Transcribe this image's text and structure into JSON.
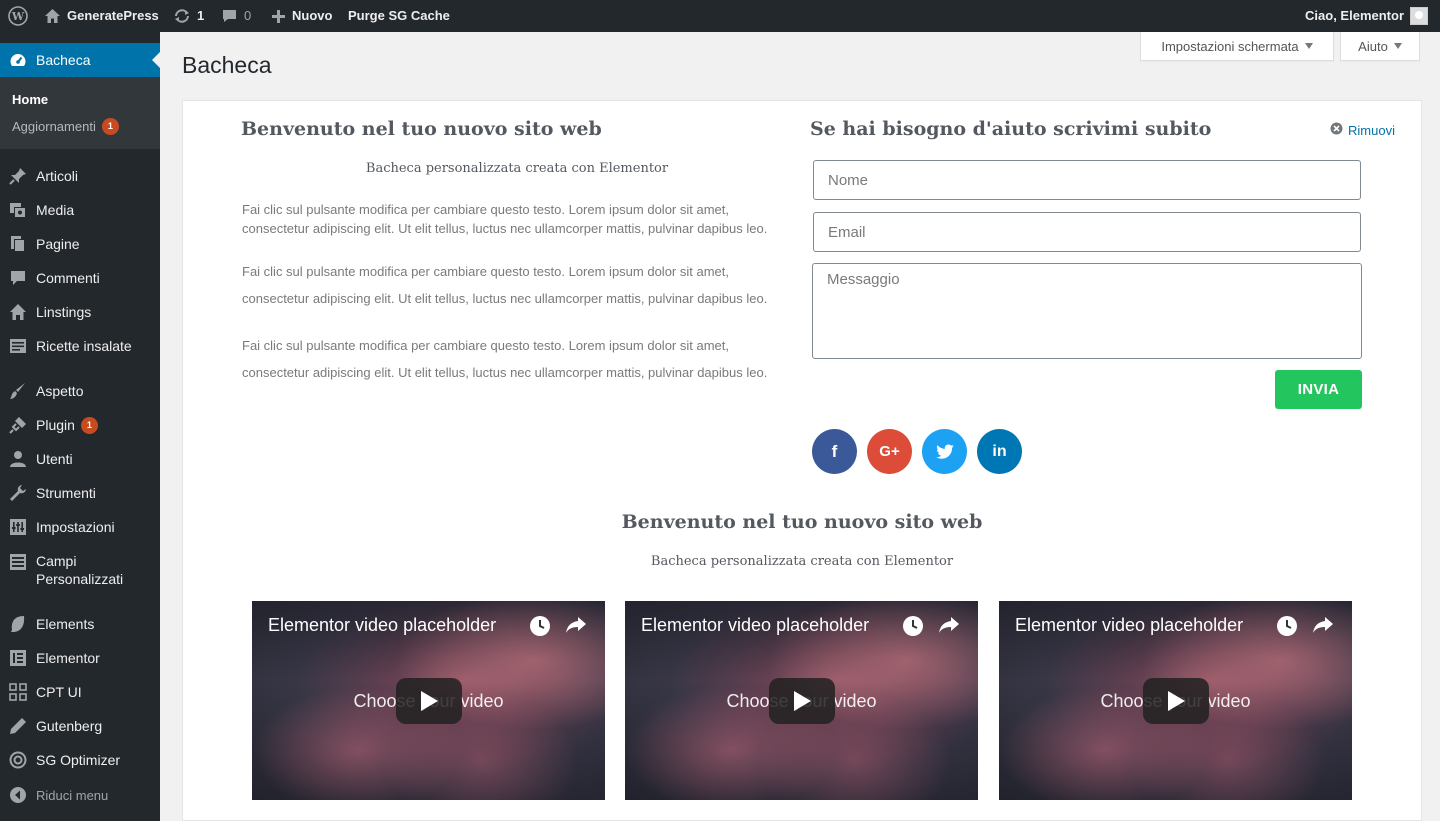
{
  "adminbar": {
    "site_name": "GeneratePress",
    "updates_count": "1",
    "comments_count": "0",
    "new_label": "Nuovo",
    "purge_label": "Purge SG Cache",
    "greeting": "Ciao, Elementor"
  },
  "sidebar": {
    "dashboard": "Bacheca",
    "sub_home": "Home",
    "sub_updates": "Aggiornamenti",
    "sub_updates_badge": "1",
    "items": [
      {
        "label": "Articoli",
        "icon": "pin-icon"
      },
      {
        "label": "Media",
        "icon": "media-icon"
      },
      {
        "label": "Pagine",
        "icon": "pages-icon"
      },
      {
        "label": "Commenti",
        "icon": "comments-icon"
      },
      {
        "label": "Linstings",
        "icon": "home-icon"
      },
      {
        "label": "Ricette insalate",
        "icon": "post-icon"
      },
      {
        "label": "Aspetto",
        "icon": "brush-icon"
      },
      {
        "label": "Plugin",
        "icon": "plugin-icon",
        "badge": "1"
      },
      {
        "label": "Utenti",
        "icon": "user-icon"
      },
      {
        "label": "Strumenti",
        "icon": "wrench-icon"
      },
      {
        "label": "Impostazioni",
        "icon": "settings-icon"
      },
      {
        "label": "Campi",
        "label2": "Personalizzati",
        "icon": "fields-icon"
      },
      {
        "label": "Elements",
        "icon": "leaf-icon"
      },
      {
        "label": "Elementor",
        "icon": "elementor-icon"
      },
      {
        "label": "CPT UI",
        "icon": "grid-icon"
      },
      {
        "label": "Gutenberg",
        "icon": "pen-icon"
      },
      {
        "label": "SG Optimizer",
        "icon": "sg-icon"
      }
    ],
    "collapse_label": "Riduci menu"
  },
  "header": {
    "title": "Bacheca",
    "screen_options": "Impostazioni schermata",
    "help": "Aiuto"
  },
  "welcome": {
    "heading": "Benvenuto nel tuo nuovo sito web",
    "subheading": "Bacheca personalizzata creata con Elementor",
    "p1": "Fai clic sul pulsante modifica per cambiare questo testo. Lorem ipsum dolor sit amet, consectetur adipiscing elit. Ut elit tellus, luctus nec ullamcorper mattis, pulvinar dapibus leo.",
    "p2_line1": "Fai clic sul pulsante modifica per cambiare questo testo. Lorem ipsum dolor sit amet,",
    "p2_line2": "consectetur adipiscing elit. Ut elit tellus, luctus nec ullamcorper mattis, pulvinar dapibus leo.",
    "p3_line1": "Fai clic sul pulsante modifica per cambiare questo testo. Lorem ipsum dolor sit amet,",
    "p3_line2": "consectetur adipiscing elit. Ut elit tellus, luctus nec ullamcorper mattis, pulvinar dapibus leo."
  },
  "contact": {
    "heading": "Se hai bisogno d'aiuto scrivimi subito",
    "remove": "Rimuovi",
    "name_placeholder": "Nome",
    "email_placeholder": "Email",
    "message_placeholder": "Messaggio",
    "send": "INVIA",
    "social": [
      {
        "name": "facebook-icon",
        "glyph": "f",
        "color": "#3b5998"
      },
      {
        "name": "google-plus-icon",
        "glyph": "G+",
        "color": "#dd4b39"
      },
      {
        "name": "twitter-icon",
        "glyph": "t",
        "color": "#1da1f2"
      },
      {
        "name": "linkedin-icon",
        "glyph": "in",
        "color": "#0077b5"
      }
    ]
  },
  "bottom": {
    "heading": "Benvenuto nel tuo nuovo sito web",
    "subheading": "Bacheca personalizzata creata con Elementor"
  },
  "videos": [
    {
      "title": "Elementor video placeholder",
      "caption": "Choose your video"
    },
    {
      "title": "Elementor video placeholder",
      "caption": "Choose your video"
    },
    {
      "title": "Elementor video placeholder",
      "caption": "Choose your video"
    }
  ],
  "colors": {
    "adminbar": "#23282d",
    "active_menu": "#0073aa",
    "send_button": "#23c65e",
    "badge": "#ca4a1f"
  }
}
